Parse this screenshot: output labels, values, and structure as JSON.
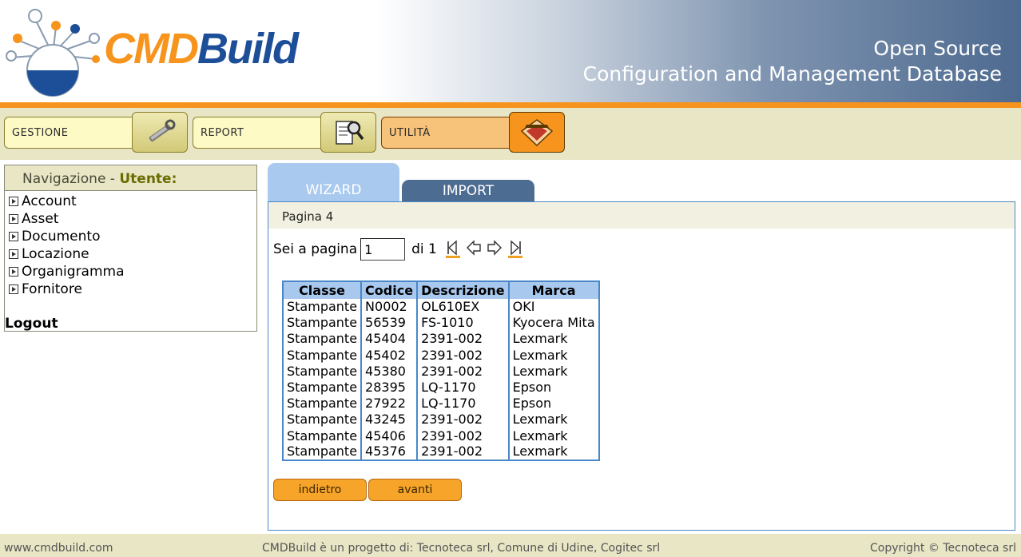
{
  "header": {
    "brand_part1": "CMD",
    "brand_part2": "Build",
    "tagline_line1": "Open Source",
    "tagline_line2": "Configuration and Management Database"
  },
  "menu": [
    {
      "label": "GESTIONE",
      "icon": "wrench-icon"
    },
    {
      "label": "REPORT",
      "icon": "report-magnifier-icon"
    },
    {
      "label": "UTILITÀ",
      "icon": "tools-utility-icon",
      "active": true
    }
  ],
  "sidebar": {
    "title": "Navigazione - ",
    "title_strong": "Utente:",
    "items": [
      "Account",
      "Asset",
      "Documento",
      "Locazione",
      "Organigramma",
      "Fornitore"
    ],
    "logout": "Logout"
  },
  "tabs": {
    "wizard": "WIZARD",
    "import": "IMPORT"
  },
  "content": {
    "section_title": "Pagina 4",
    "pager": {
      "prefix": "Sei a pagina",
      "current_page": "1",
      "of_label": "di 1"
    },
    "table": {
      "columns": [
        "Classe",
        "Codice",
        "Descrizione",
        "Marca"
      ],
      "rows": [
        [
          "Stampante",
          "N0002",
          "OL610EX",
          "OKI"
        ],
        [
          "Stampante",
          "56539",
          "FS-1010",
          "Kyocera Mita"
        ],
        [
          "Stampante",
          "45404",
          "2391-002",
          "Lexmark"
        ],
        [
          "Stampante",
          "45402",
          "2391-002",
          "Lexmark"
        ],
        [
          "Stampante",
          "45380",
          "2391-002",
          "Lexmark"
        ],
        [
          "Stampante",
          "28395",
          "LQ-1170",
          "Epson"
        ],
        [
          "Stampante",
          "27922",
          "LQ-1170",
          "Epson"
        ],
        [
          "Stampante",
          "43245",
          "2391-002",
          "Lexmark"
        ],
        [
          "Stampante",
          "45406",
          "2391-002",
          "Lexmark"
        ],
        [
          "Stampante",
          "45376",
          "2391-002",
          "Lexmark"
        ]
      ]
    },
    "buttons": {
      "back": "indietro",
      "next": "avanti"
    }
  },
  "footer": {
    "left": "www.cmdbuild.com",
    "center": "CMDBuild è un progetto di: Tecnoteca srl, Comune di Udine, Cogitec srl",
    "right": "Copyright © Tecnoteca srl"
  },
  "colors": {
    "accent_orange": "#f7941d",
    "brand_blue": "#1d4f99",
    "panel_border": "#4a87c8",
    "menu_bar": "#e8e6c5"
  }
}
